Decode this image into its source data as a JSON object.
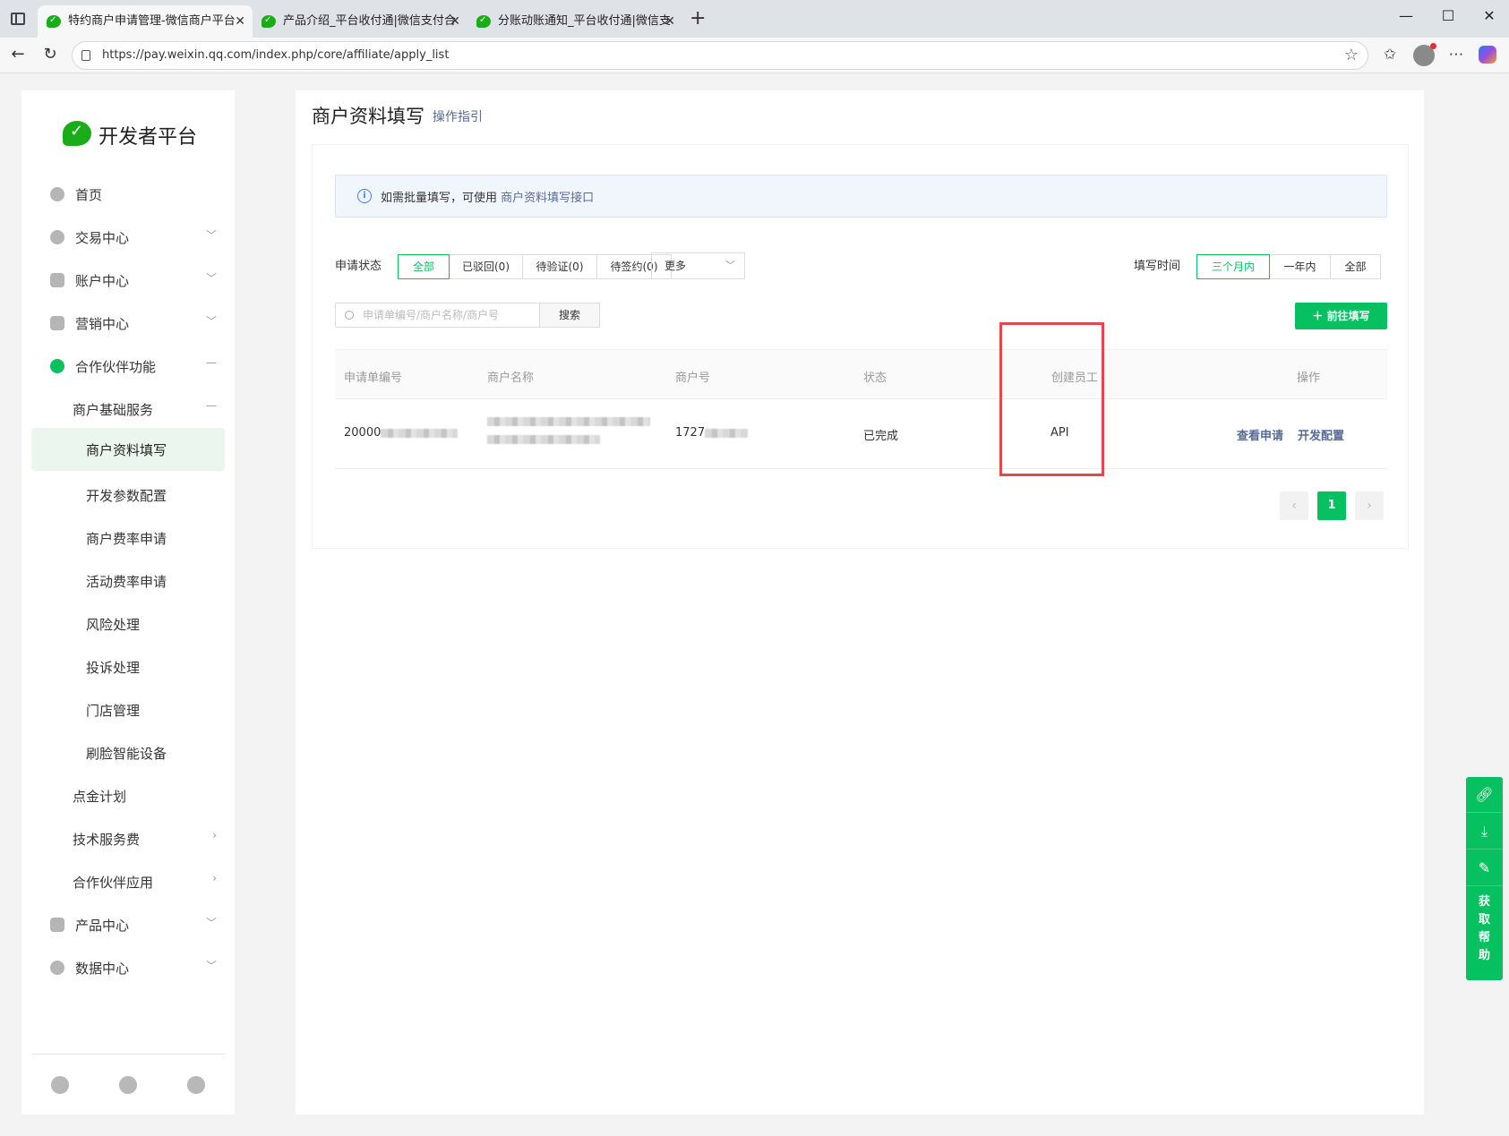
{
  "browser": {
    "tabs": [
      {
        "title": "特约商户申请管理-微信商户平台",
        "active": true
      },
      {
        "title": "产品介绍_平台收付通|微信支付合",
        "active": false
      },
      {
        "title": "分账动账通知_平台收付通|微信支",
        "active": false
      }
    ],
    "url": "https://pay.weixin.qq.com/index.php/core/affiliate/apply_list"
  },
  "sidebar": {
    "logo_text": "开发者平台",
    "items": [
      {
        "label": "首页"
      },
      {
        "label": "交易中心"
      },
      {
        "label": "账户中心"
      },
      {
        "label": "营销中心"
      },
      {
        "label": "合作伙伴功能"
      },
      {
        "label": "商户基础服务"
      },
      {
        "label": "商户资料填写"
      },
      {
        "label": "开发参数配置"
      },
      {
        "label": "商户费率申请"
      },
      {
        "label": "活动费率申请"
      },
      {
        "label": "风险处理"
      },
      {
        "label": "投诉处理"
      },
      {
        "label": "门店管理"
      },
      {
        "label": "刷脸智能设备"
      },
      {
        "label": "点金计划"
      },
      {
        "label": "技术服务费"
      },
      {
        "label": "合作伙伴应用"
      },
      {
        "label": "产品中心"
      },
      {
        "label": "数据中心"
      }
    ]
  },
  "main": {
    "title": "商户资料填写",
    "guide_link": "操作指引",
    "info": {
      "text": "如需批量填写，可使用",
      "link": "商户资料填写接口"
    },
    "filters": {
      "status_label": "申请状态",
      "status_options": [
        "全部",
        "已驳回(0)",
        "待验证(0)",
        "待签约(0)"
      ],
      "more_label": "更多",
      "time_label": "填写时间",
      "time_options": [
        "三个月内",
        "一年内",
        "全部"
      ]
    },
    "search": {
      "placeholder": "申请单编号/商户名称/商户号",
      "button": "搜索"
    },
    "go_button": "前往填写",
    "table": {
      "columns": [
        "申请单编号",
        "商户名称",
        "商户号",
        "状态",
        "创建员工",
        "操作"
      ],
      "rows": [
        {
          "apply_no": "20000",
          "merchant_id": "1727",
          "status": "已完成",
          "creator": "API",
          "actions": [
            "查看申请",
            "开发配置"
          ]
        }
      ]
    },
    "pagination": {
      "current": "1"
    }
  },
  "float_help": {
    "label_chars": [
      "获",
      "取",
      "帮",
      "助"
    ]
  },
  "colors": {
    "brand_green": "#07c160",
    "link_blue": "#576b95",
    "highlight_red": "#e0484c"
  }
}
